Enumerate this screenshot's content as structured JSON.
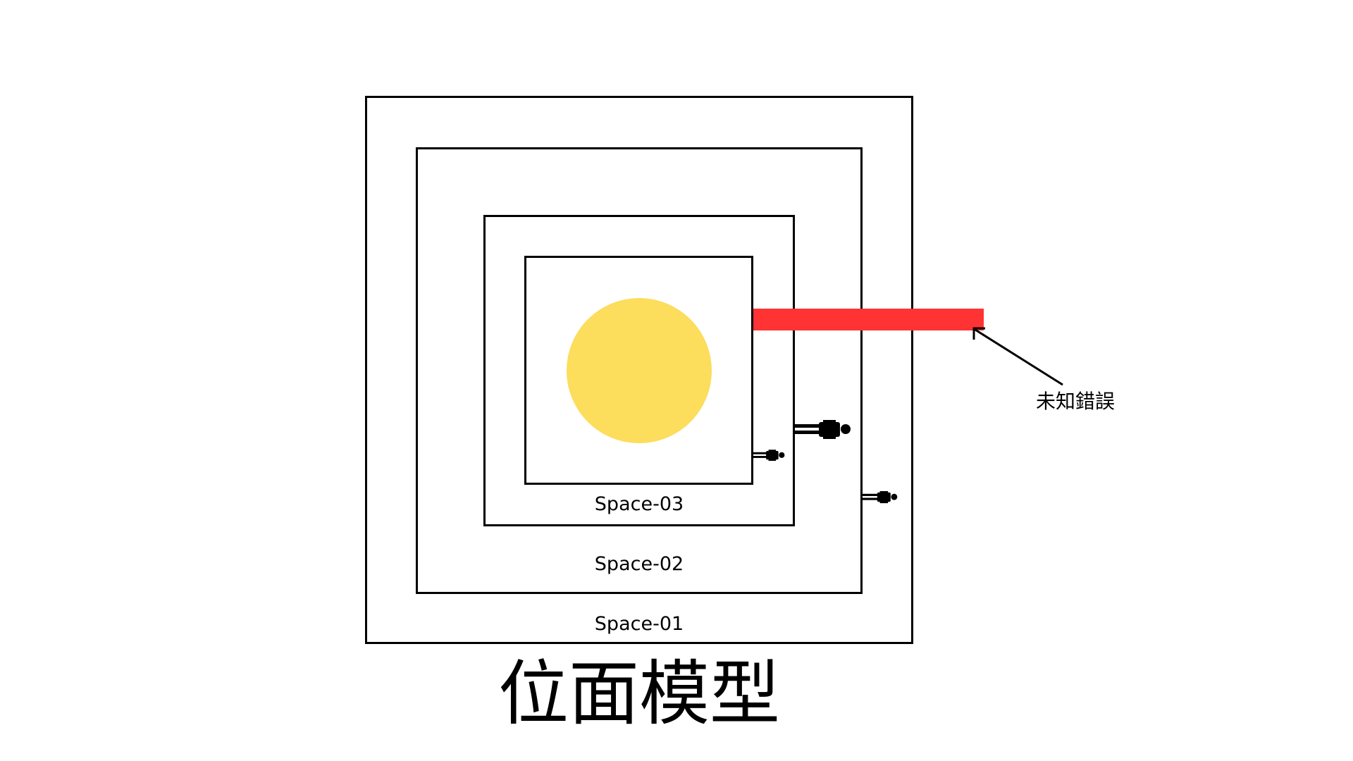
{
  "title": "位面模型",
  "spaces": [
    {
      "label": "Space-01"
    },
    {
      "label": "Space-02"
    },
    {
      "label": "Space-03"
    }
  ],
  "error": {
    "label": "未知錯誤"
  },
  "colors": {
    "sun": "#fcdd5c",
    "error_bar": "#ff3333",
    "line": "#000000",
    "background": "#ffffff"
  },
  "icons": [
    "person-lying-icon",
    "person-lying-icon",
    "person-lying-icon",
    "arrow-icon"
  ]
}
